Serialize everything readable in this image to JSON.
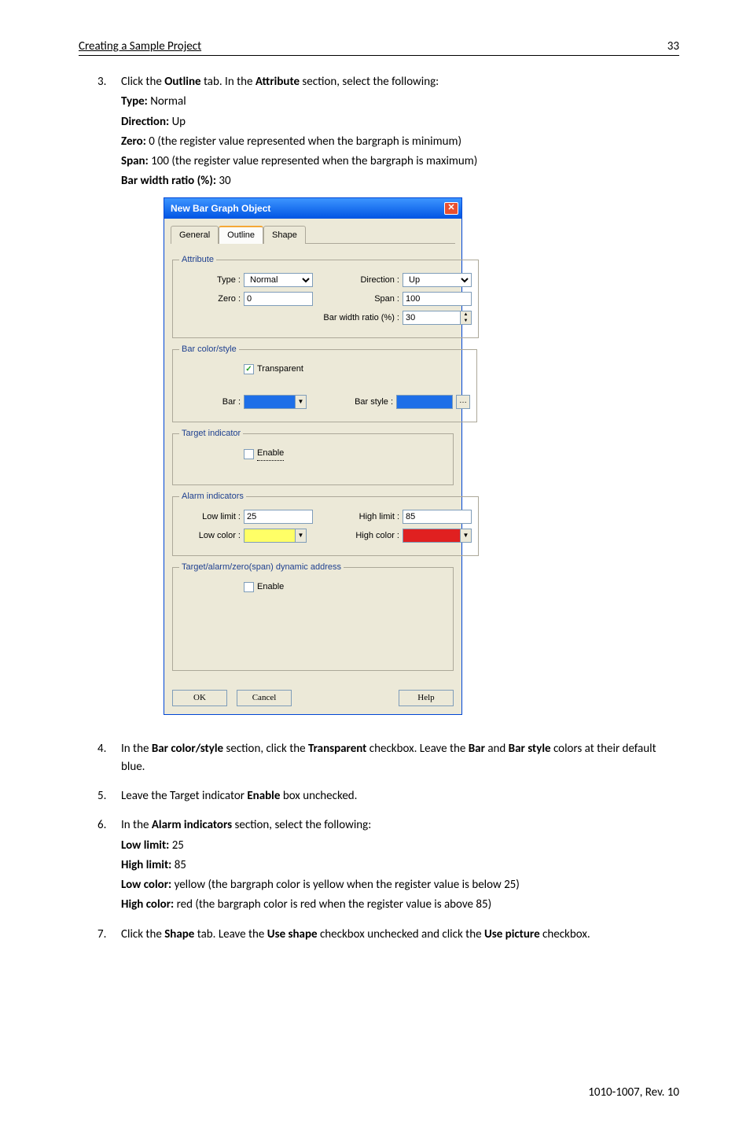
{
  "header": {
    "title": "Creating a Sample Project",
    "page_number": "33"
  },
  "footer": {
    "doc_id": "1010-1007, Rev. 10"
  },
  "steps": {
    "s3": {
      "num": "3.",
      "lead1": "Click the ",
      "b1": "Outline",
      "lead2": " tab. In the ",
      "b2": "Attribute",
      "lead3": " section, select the following:",
      "type_lbl": "Type: ",
      "type_val": "Normal",
      "dir_lbl": "Direction: ",
      "dir_val": "Up",
      "zero_lbl": "Zero: ",
      "zero_val": "0 (the register value represented when the bargraph is minimum)",
      "span_lbl": "Span: ",
      "span_val": "100 (the register value represented when the bargraph is maximum)",
      "bwr_lbl": "Bar width ratio (%): ",
      "bwr_val": "30"
    },
    "s4": {
      "num": "4.",
      "t1": "In the ",
      "b1": "Bar color/style",
      "t2": " section, click the ",
      "b2": "Transparent",
      "t3": " checkbox. Leave the ",
      "b3": "Bar",
      "t4": " and ",
      "b4": "Bar style",
      "t5": " colors at their default blue."
    },
    "s5": {
      "num": "5.",
      "t1": "Leave the Target indicator ",
      "b1": "Enable",
      "t2": " box unchecked."
    },
    "s6": {
      "num": "6.",
      "t1": "In the ",
      "b1": "Alarm indicators",
      "t2": " section, select the following:",
      "ll_lbl": "Low limit: ",
      "ll_val": "25",
      "hl_lbl": "High limit: ",
      "hl_val": "85",
      "lc_lbl": "Low color: ",
      "lc_val": "yellow (the bargraph color is yellow when the register value is below 25)",
      "hc_lbl": "High color: ",
      "hc_val": "red (the bargraph color is red when the register value is above 85)"
    },
    "s7": {
      "num": "7.",
      "t1": "Click the ",
      "b1": "Shape",
      "t2": " tab. Leave the ",
      "b2": "Use shape",
      "t3": " checkbox unchecked and click the ",
      "b3": "Use picture",
      "t4": " checkbox."
    }
  },
  "dialog": {
    "title": "New  Bar Graph Object",
    "tabs": {
      "general": "General",
      "outline": "Outline",
      "shape": "Shape"
    },
    "attribute": {
      "legend": "Attribute",
      "type_lbl": "Type :",
      "type_val": "Normal",
      "dir_lbl": "Direction :",
      "dir_val": "Up",
      "zero_lbl": "Zero :",
      "zero_val": "0",
      "span_lbl": "Span :",
      "span_val": "100",
      "bwr_lbl": "Bar width ratio (%) :",
      "bwr_val": "30"
    },
    "barcolor": {
      "legend": "Bar color/style",
      "transparent": "Transparent",
      "bar_lbl": "Bar :",
      "barstyle_lbl": "Bar style :"
    },
    "target": {
      "legend": "Target indicator",
      "enable": "Enable"
    },
    "alarm": {
      "legend": "Alarm indicators",
      "ll_lbl": "Low limit :",
      "ll_val": "25",
      "hl_lbl": "High limit :",
      "hl_val": "85",
      "lc_lbl": "Low color :",
      "hc_lbl": "High color :"
    },
    "dyn": {
      "legend": "Target/alarm/zero(span) dynamic address",
      "enable": "Enable"
    },
    "buttons": {
      "ok": "OK",
      "cancel": "Cancel",
      "help": "Help"
    },
    "colors": {
      "bar": "#1e6fe8",
      "barstyle": "#1e6fe8",
      "low": "#ffff66",
      "high": "#e02020"
    }
  }
}
